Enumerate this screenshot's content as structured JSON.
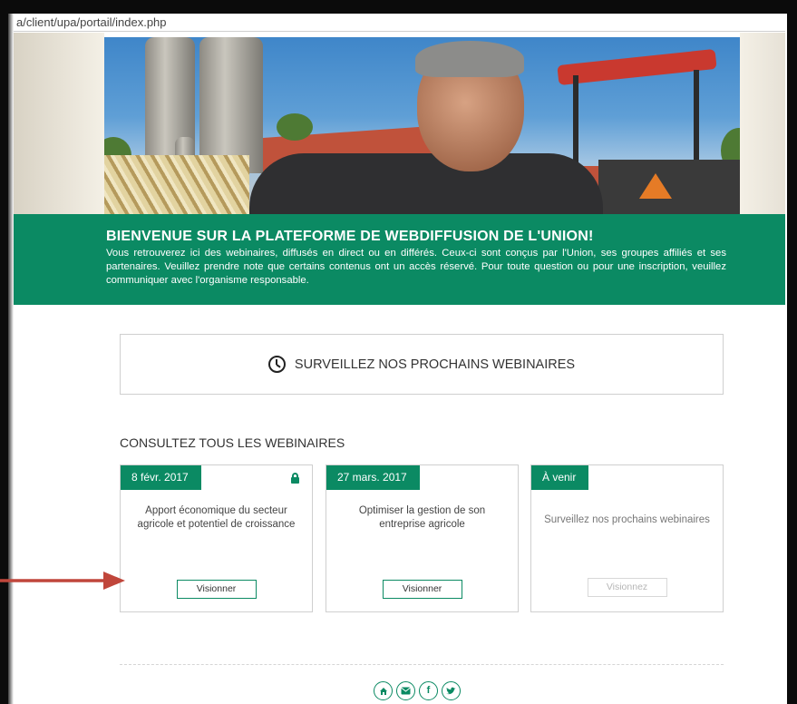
{
  "browser": {
    "url": "a/client/upa/portail/index.php"
  },
  "banner": {
    "title": "BIENVENUE SUR LA PLATEFORME DE WEBDIFFUSION DE L'UNION!",
    "text": "Vous retrouverez ici des webinaires, diffusés en direct ou en différés. Ceux-ci sont conçus par l'Union, ses groupes affiliés et ses partenaires. Veuillez prendre note que certains contenus ont un accès réservé. Pour toute question ou pour une inscription, veuillez communiquer avec l'organisme responsable."
  },
  "upcoming": {
    "label": "SURVEILLEZ NOS PROCHAINS WEBINAIRES",
    "icon": "clock-icon"
  },
  "section": {
    "title": "CONSULTEZ TOUS LES WEBINAIRES"
  },
  "cards": [
    {
      "date": "8 févr. 2017",
      "locked": true,
      "text": "Apport économique du secteur agricole et potentiel de croissance",
      "button": "Visionner"
    },
    {
      "date": "27 mars. 2017",
      "locked": false,
      "text": "Optimiser la gestion de son entreprise agricole",
      "button": "Visionner"
    },
    {
      "date": "À venir",
      "locked": false,
      "text": "Surveillez nos prochains webinaires",
      "button": "Visionnez"
    }
  ],
  "annotation": {
    "arrow_color": "#c0463b"
  },
  "footer": {
    "social": [
      "home-icon",
      "mail-icon",
      "facebook-icon",
      "twitter-icon"
    ]
  },
  "colors": {
    "brand_green": "#0b8a63"
  }
}
